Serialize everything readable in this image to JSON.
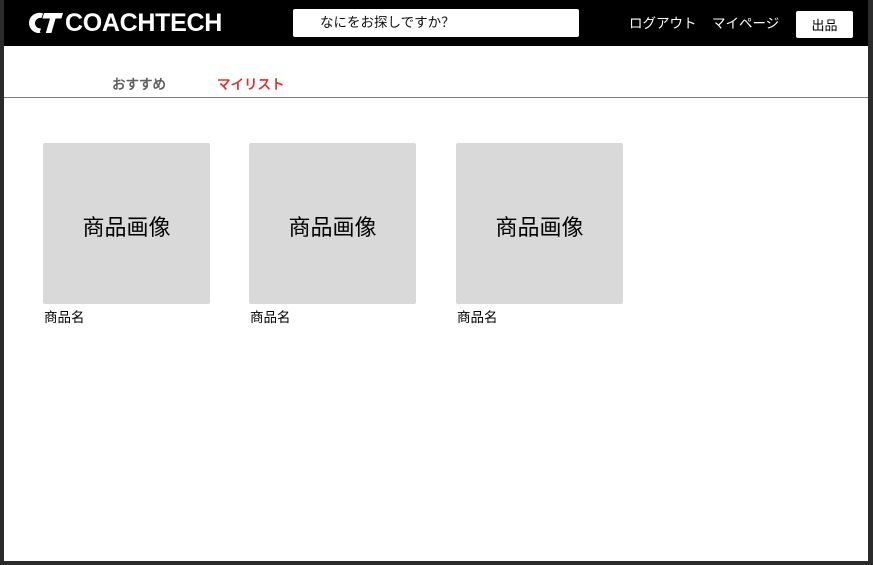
{
  "header": {
    "logo_text": "COACHTECH",
    "logo_mark": "ct-logo-icon",
    "search_placeholder": "なにをお探しですか？",
    "search_value": "",
    "nav": {
      "logout_label": "ログアウト",
      "mypage_label": "マイページ"
    },
    "sell_label": "出品"
  },
  "tabs": [
    {
      "label": "おすすめ",
      "active": false
    },
    {
      "label": "マイリスト",
      "active": true
    }
  ],
  "products": [
    {
      "image_label": "商品画像",
      "name": "商品名"
    },
    {
      "image_label": "商品画像",
      "name": "商品名"
    },
    {
      "image_label": "商品画像",
      "name": "商品名"
    }
  ],
  "colors": {
    "header_bg": "#000000",
    "active_tab": "#e0312c",
    "inactive_tab": "#5f5f5f",
    "placeholder_bg": "#d9d9d9"
  }
}
